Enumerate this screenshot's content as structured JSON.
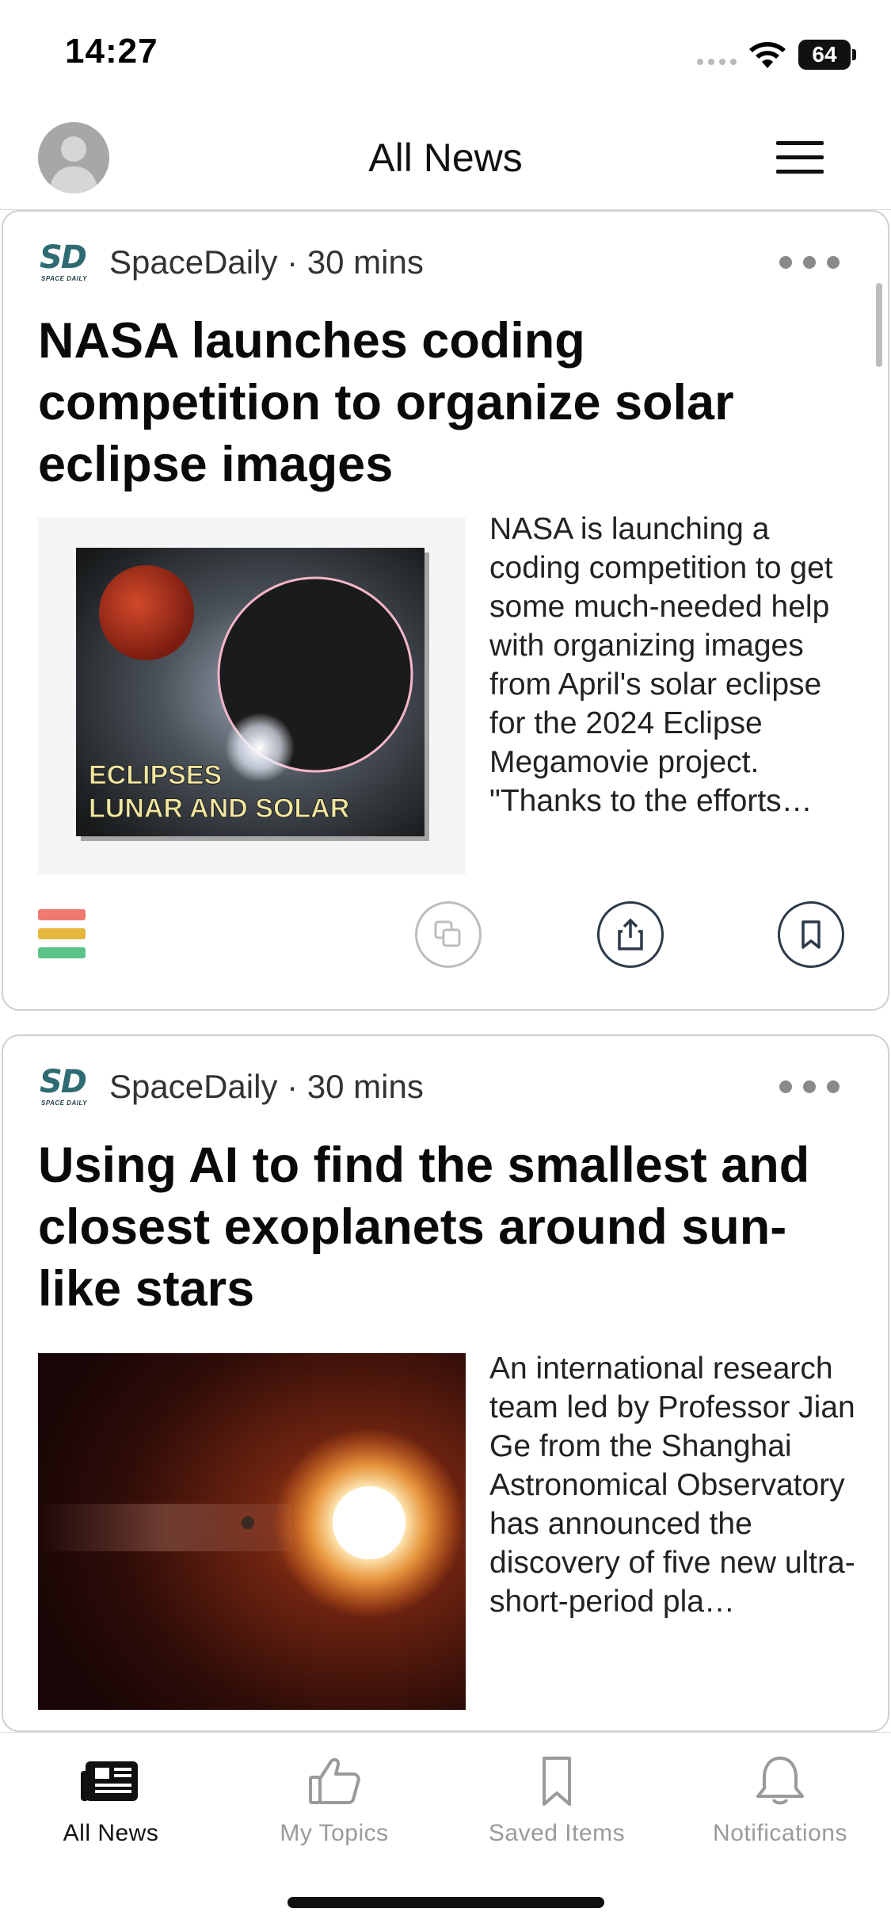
{
  "status_bar": {
    "time": "14:27",
    "battery": "64",
    "icons": [
      "cellular-signal-icon",
      "wifi-icon",
      "battery-icon"
    ]
  },
  "header": {
    "title": "All News",
    "avatar_icon": "user-avatar-icon",
    "menu_icon": "hamburger-menu-icon"
  },
  "articles": [
    {
      "source": "SpaceDaily",
      "logo_text": "SD",
      "logo_subtext": "SPACE DAILY",
      "age": "30 mins",
      "meta": "SpaceDaily · 30 mins",
      "headline": "NASA launches coding competition to organize solar eclipse images",
      "image_caption_line1": "ECLIPSES",
      "image_caption_line2": "LUNAR AND SOLAR",
      "summary": "NASA is launching a coding competition to get some much-needed help with organizing images from April's solar eclipse for the 2024 Eclipse Megamovie project. \"Thanks to the efforts…",
      "category_colors": [
        "#f07a72",
        "#e3b83c",
        "#5cc48a"
      ]
    },
    {
      "source": "SpaceDaily",
      "logo_text": "SD",
      "logo_subtext": "SPACE DAILY",
      "age": "30 mins",
      "meta": "SpaceDaily · 30 mins",
      "headline": "Using AI to find the smallest and closest exoplanets around sun-like stars",
      "summary": "An international research team led by Professor Jian Ge from the Shanghai Astronomical Observatory has announced the discovery of five new ultra-short-period pla…"
    }
  ],
  "tab_bar": {
    "tabs": [
      {
        "label": "All News",
        "icon": "newspaper-icon",
        "active": true
      },
      {
        "label": "My Topics",
        "icon": "thumbs-up-icon",
        "active": false
      },
      {
        "label": "Saved Items",
        "icon": "bookmark-icon",
        "active": false
      },
      {
        "label": "Notifications",
        "icon": "bell-icon",
        "active": false
      }
    ]
  },
  "colors": {
    "accent_dark": "#2b3a4a",
    "logo_teal": "#2f6b73",
    "inactive_tab": "#9a9a9a"
  }
}
